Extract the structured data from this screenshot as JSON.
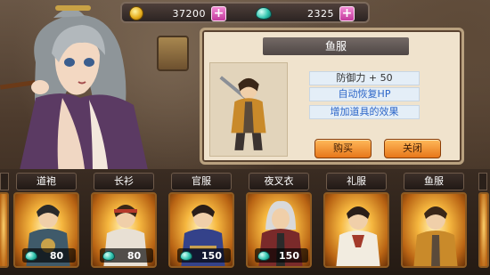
{
  "resources": {
    "gold": {
      "icon": "gold-coin-icon",
      "value": "37200"
    },
    "gems": {
      "icon": "gem-icon",
      "value": "2325"
    },
    "plus_label": "+"
  },
  "item_panel": {
    "title": "鱼服",
    "stats": [
      "防御力 + 50",
      "自动恢复HP",
      "增加道具的效果"
    ],
    "buy_label": "购买",
    "close_label": "关闭"
  },
  "costumes": [
    {
      "name": "道袍",
      "price": "80",
      "colors": {
        "body": "#3f5a6a",
        "hair": "#2a2a2a",
        "accent": "#c9a24a"
      }
    },
    {
      "name": "长衫",
      "price": "80",
      "colors": {
        "body": "#e8e0d4",
        "hair": "#3a2718",
        "accent": "#b63a2a"
      }
    },
    {
      "name": "官服",
      "price": "150",
      "colors": {
        "body": "#34428a",
        "hair": "#2a1e18",
        "accent": "#c8a050"
      }
    },
    {
      "name": "夜叉衣",
      "price": "150",
      "colors": {
        "body": "#7a2a2a",
        "hair": "#d9d9d9",
        "accent": "#2a2a2a"
      }
    },
    {
      "name": "礼服",
      "price": "",
      "colors": {
        "body": "#f2ece0",
        "hair": "#2a1e18",
        "accent": "#a33a2a"
      }
    },
    {
      "name": "鱼服",
      "price": "",
      "colors": {
        "body": "#c98a2a",
        "hair": "#3a2718",
        "accent": "#5a4a3a"
      }
    }
  ],
  "colors": {
    "panel_bg": "#f0e3cd",
    "button_orange": "#e7771a",
    "plus_pink": "#c3399c",
    "stat_blue": "#2d66c8"
  }
}
